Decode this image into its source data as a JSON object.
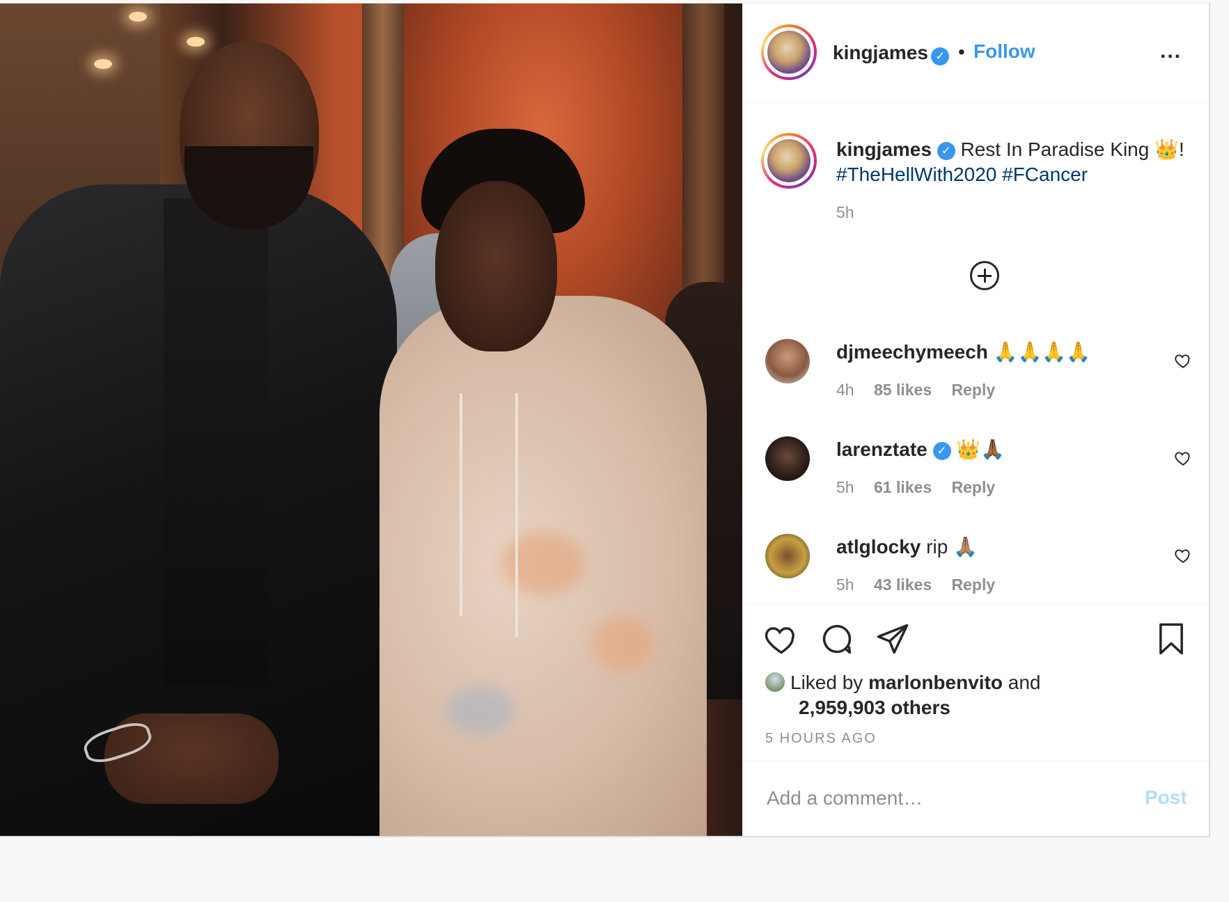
{
  "post": {
    "author": "kingjames",
    "verified_icon": "verified-badge-icon",
    "follow_label": "Follow",
    "header_separator": "•",
    "more_label": "..."
  },
  "caption": {
    "username": "kingjames",
    "text": "Rest In Paradise King 👑!",
    "hashtags": "#TheHellWith2020 #FCancer",
    "time": "5h"
  },
  "comments": [
    {
      "username": "djmeechymeech",
      "text": "🙏🙏🙏🙏",
      "verified": false,
      "time": "4h",
      "likes": "85 likes",
      "reply": "Reply"
    },
    {
      "username": "larenztate",
      "text": "👑🙏🏾",
      "verified": true,
      "time": "5h",
      "likes": "61 likes",
      "reply": "Reply"
    },
    {
      "username": "atlglocky",
      "text": "rip 🙏🏽",
      "verified": false,
      "time": "5h",
      "likes": "43 likes",
      "reply": "Reply"
    }
  ],
  "likes": {
    "prefix": "Liked by",
    "user": "marlonbenvito",
    "connector": "and",
    "count": "2,959,903 others"
  },
  "timestamp": "5 HOURS AGO",
  "add_comment": {
    "placeholder": "Add a comment…",
    "post_label": "Post"
  },
  "colors": {
    "link_blue": "#3897f0",
    "hashtag_blue": "#00376b",
    "muted": "#8e8e8e",
    "post_disabled": "#b3dbff"
  }
}
